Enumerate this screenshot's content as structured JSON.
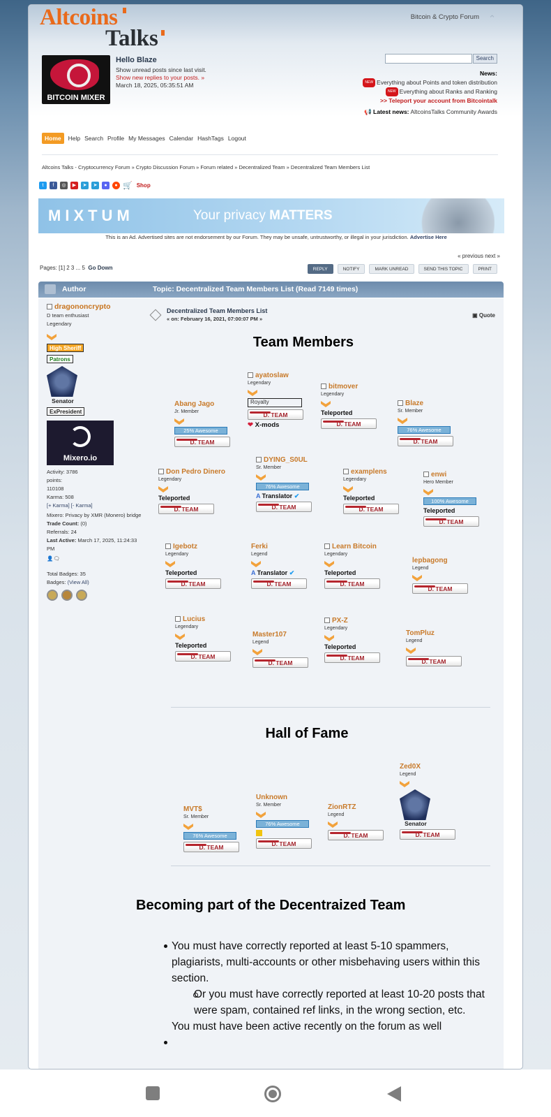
{
  "header": {
    "logo_top": "Altcoins",
    "logo_bottom": "Talks",
    "forum_name": "Bitcoin & Crypto Forum",
    "banner_label": "BITCOIN MIXER",
    "hello": "Hello Blaze",
    "unread": "Show unread posts since last visit.",
    "replies": "Show new replies to your posts.",
    "datetime": "March 18, 2025, 05:35:51 AM",
    "search_button": "Search",
    "news_label": "News:",
    "news1": "Everything about Points and token distribution",
    "news2": "Everything about Ranks and Ranking",
    "news3": ">> Teleport your account from Bitcointalk",
    "latest_label": "Latest news:",
    "latest_text": "AltcoinsTalks Community Awards",
    "new_badge": "NEW"
  },
  "menu": [
    "Home",
    "Help",
    "Search",
    "Profile",
    "My Messages",
    "Calendar",
    "HashTags",
    "Logout"
  ],
  "breadcrumb": "Altcoins Talks - Cryptocurrency Forum  »  Crypto Discussion Forum  »  Forum related  »  Decentralized Team  »  Decentralized Team Members List",
  "shop": "Shop",
  "ad": {
    "brand": "MIXTUM",
    "slogan_pre": "Your privacy ",
    "slogan_bold": "MATTERS",
    "disclaimer": "This is an Ad. Advertised sites are not endorsement by our Forum. They may be unsafe, untrustworthy, or illegal in your jurisdiction.",
    "advertise": "Advertise Here"
  },
  "nav": {
    "prevnext": "« previous next »",
    "pages_label": "Pages:",
    "pages": "[1] 2 3 ... 5",
    "go_down": "Go Down"
  },
  "buttons": [
    "REPLY",
    "NOTIFY",
    "MARK UNREAD",
    "SEND THIS TOPIC",
    "PRINT"
  ],
  "catbar": {
    "author": "Author",
    "topic": "Topic: Decentralized Team Members List  (Read 7149 times)"
  },
  "poster": {
    "name": "dragononcrypto",
    "title": "D team enthusiast",
    "rank": "Legendary",
    "badge1": "High Sheriff",
    "badge2": "Patrons",
    "senator": "Senator",
    "expresident": "ExPresident",
    "mixero": "Mixero.io",
    "activity": "Activity: 3786",
    "points_label": "points:",
    "points": "110108",
    "karma": "Karma: 508",
    "karma_links": "[+ Karma] [- Karma]",
    "sig": "Mixero: Privacy by XMR (Monero) bridge",
    "trade": "Trade Count:",
    "trade_val": "(0)",
    "referrals": "Referrals: 24",
    "last_active": "Last Active:",
    "last_active_val": "March 17, 2025, 11:24:33 PM",
    "total_badges": "Total Badges: 35",
    "badges": "Badges:",
    "view_all": "(View All)"
  },
  "post": {
    "title": "Decentralized Team Members List",
    "date_pre": "« on:",
    "date": "February 16, 2021, 07:00:07 PM »",
    "quote": "Quote"
  },
  "sections": {
    "team": "Team Members",
    "hof": "Hall of Fame",
    "becoming": "Becoming part of the Decentraized Team"
  },
  "common": {
    "dteam": "D. TEAM",
    "teleported": "Teleported",
    "translator": "Translator",
    "xmods": "X-mods",
    "royalty": "Royalty",
    "aw76": "76% Awesome",
    "aw25": "25% Awesome",
    "aw100": "100% Awesome"
  },
  "members": [
    {
      "name": "Abang Jago",
      "rank": "Jr. Member"
    },
    {
      "name": "ayatoslaw",
      "rank": "Legendary"
    },
    {
      "name": "bitmover",
      "rank": "Legendary"
    },
    {
      "name": "Blaze",
      "rank": "Sr. Member"
    },
    {
      "name": "Don Pedro Dinero",
      "rank": "Legendary"
    },
    {
      "name": "DYING_S0UL",
      "rank": "Sr. Member"
    },
    {
      "name": "examplens",
      "rank": "Legendary"
    },
    {
      "name": "enwi",
      "rank": "Hero Member"
    },
    {
      "name": "Igebotz",
      "rank": "Legendary"
    },
    {
      "name": "Ferki",
      "rank": "Legend"
    },
    {
      "name": "Learn Bitcoin",
      "rank": "Legendary"
    },
    {
      "name": "lepbagong",
      "rank": "Legend"
    },
    {
      "name": "Lucius",
      "rank": "Legendary"
    },
    {
      "name": "Master107",
      "rank": "Legend"
    },
    {
      "name": "PX-Z",
      "rank": "Legendary"
    },
    {
      "name": "TomPluz",
      "rank": "Legend"
    }
  ],
  "hof": [
    {
      "name": "MVT$",
      "rank": "Sr. Member"
    },
    {
      "name": "Unknown",
      "rank": "Sr. Member"
    },
    {
      "name": "ZionRTZ",
      "rank": "Legend"
    },
    {
      "name": "Zed0X",
      "rank": "Legend",
      "extra": "Senator"
    }
  ],
  "rules": {
    "r1": "You must have correctly reported at least 5-10 spammers, plagiarists, multi-accounts or other misbehaving users within this section.",
    "r1a": "Or you must have correctly reported at least 10-20 posts that were spam, contained ref links, in the wrong section, etc.",
    "r2": "You must have been active recently on the forum as well"
  },
  "colors": {
    "accent": "#f39b24",
    "member_name": "#c87a2a",
    "link": "#334466",
    "dteam": "#a3232b"
  },
  "system_nav": [
    "square-icon",
    "circle-icon",
    "back-triangle-icon"
  ]
}
